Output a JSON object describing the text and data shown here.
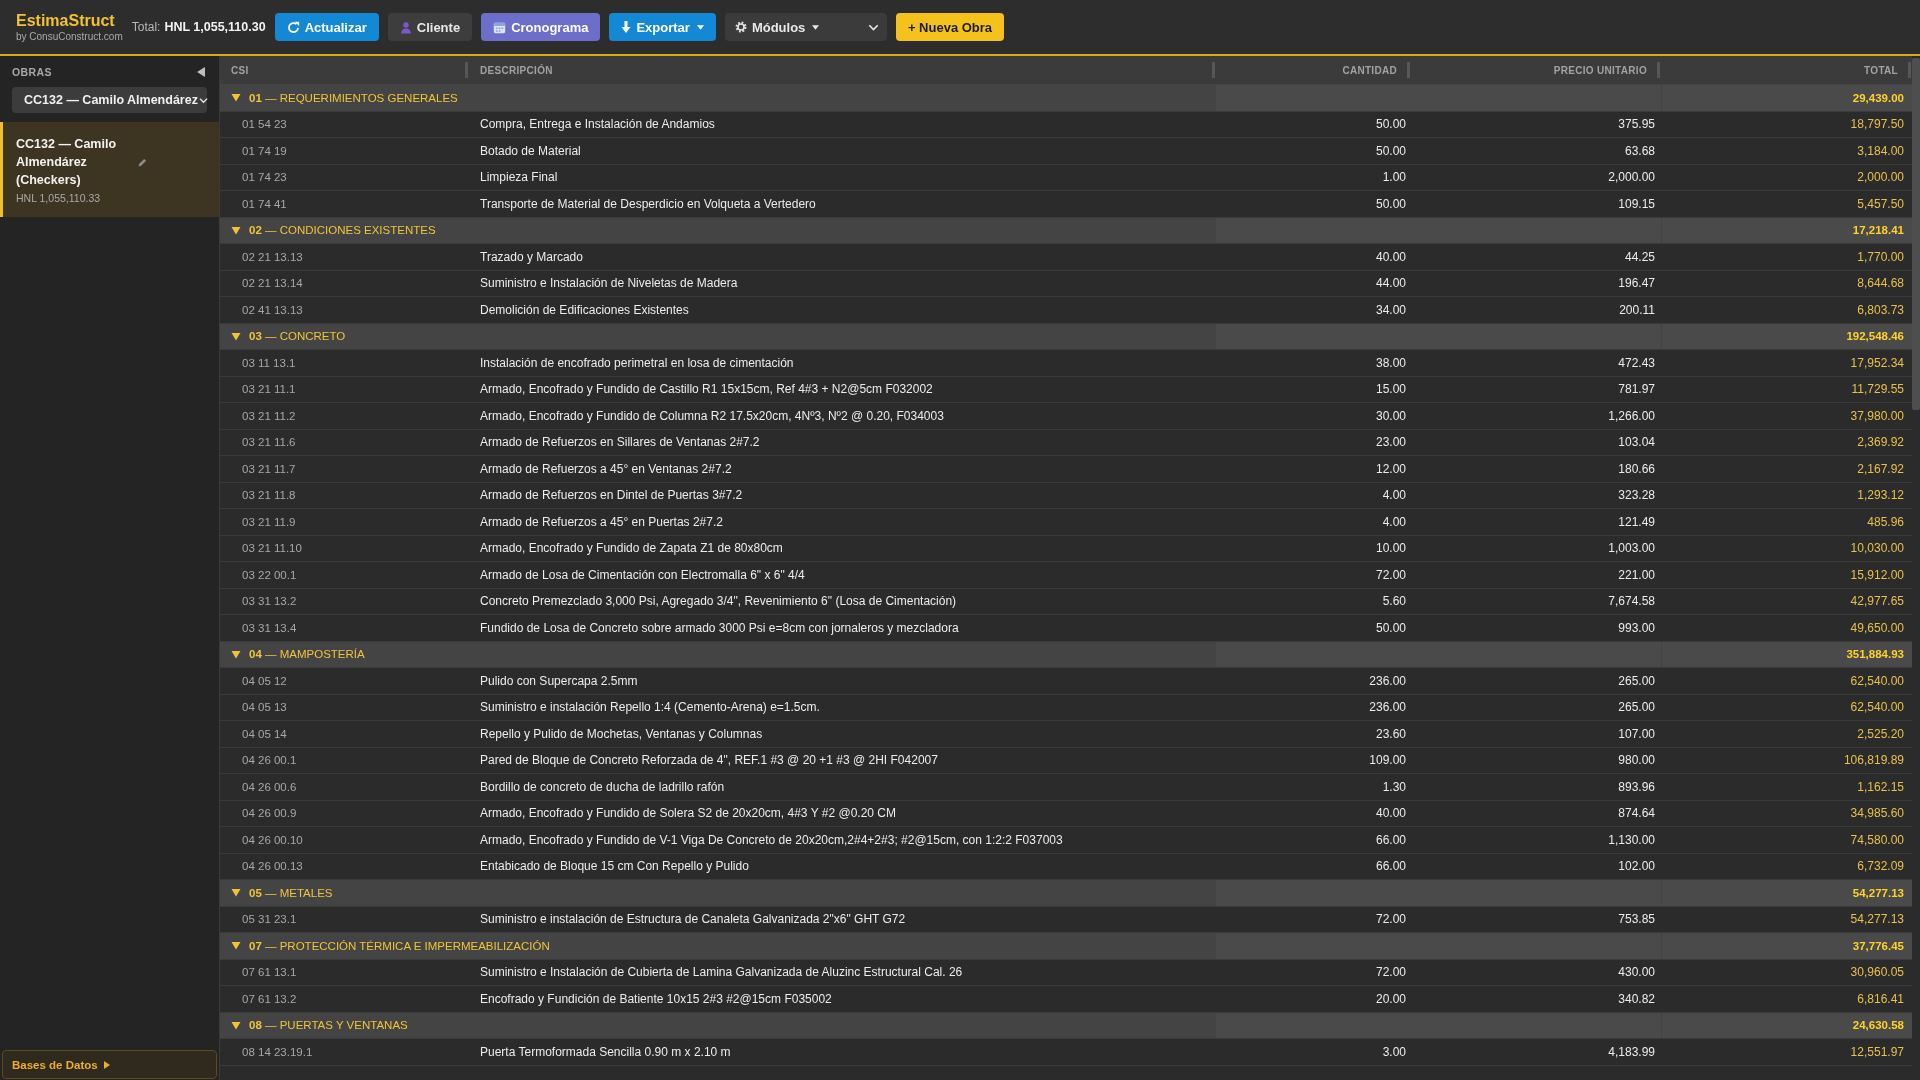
{
  "app": {
    "title": "EstimaStruct",
    "subtitle": "by ConsuConstruct.com"
  },
  "toolbar": {
    "total_label": "Total:",
    "total_value": "HNL 1,055,110.30",
    "controls": [
      {
        "kind": "refresh",
        "label": "Actualizar",
        "menu": false
      },
      {
        "kind": "client",
        "label": "Cliente",
        "menu": false
      },
      {
        "kind": "schedule",
        "label": "Cronograma",
        "menu": false
      },
      {
        "kind": "export",
        "label": "Exportar",
        "menu": true
      },
      {
        "kind": "select",
        "label": "Módulos",
        "menu": true
      },
      {
        "kind": "add",
        "label": "+ Nueva Obra",
        "menu": false
      }
    ]
  },
  "sidebar": {
    "title": "OBRAS",
    "project_select": {
      "value": "CC132 — Camilo Almendárez"
    },
    "projects": [
      {
        "name": "CC132 — Camilo Almendárez (Checkers)",
        "amount": "HNL 1,055,110.33",
        "selected": true
      }
    ],
    "footer_button": {
      "label": "Bases de Datos"
    }
  },
  "table": {
    "columns": [
      "CSI",
      "DESCRIPCIÓN",
      "CANTIDAD",
      "PRECIO UNITARIO",
      "TOTAL"
    ],
    "groups": [
      {
        "label": "**01** — REQUERIMIENTOS GENERALES",
        "total": "29,439.00",
        "expanded": true,
        "rows": [
          {
            "csi": "01 54 23",
            "description": "Compra, Entrega e Instalación de Andamios",
            "quantity": "50.00",
            "unit_price": "375.95",
            "total": "18,797.50"
          },
          {
            "csi": "01 74 19",
            "description": "Botado de Material",
            "quantity": "50.00",
            "unit_price": "63.68",
            "total": "3,184.00"
          },
          {
            "csi": "01 74 23",
            "description": "Limpieza Final",
            "quantity": "1.00",
            "unit_price": "2,000.00",
            "total": "2,000.00"
          },
          {
            "csi": "01 74 41",
            "description": "Transporte de Material de Desperdicio en Volqueta a Vertedero",
            "quantity": "50.00",
            "unit_price": "109.15",
            "total": "5,457.50"
          }
        ]
      },
      {
        "label": "**02** — CONDICIONES EXISTENTES",
        "total": "17,218.41",
        "expanded": true,
        "rows": [
          {
            "csi": "02 21 13.13",
            "description": "Trazado y Marcado",
            "quantity": "40.00",
            "unit_price": "44.25",
            "total": "1,770.00"
          },
          {
            "csi": "02 21 13.14",
            "description": "Suministro e Instalación de Niveletas de Madera",
            "quantity": "44.00",
            "unit_price": "196.47",
            "total": "8,644.68"
          },
          {
            "csi": "02 41 13.13",
            "description": "Demolición de Edificaciones Existentes",
            "quantity": "34.00",
            "unit_price": "200.11",
            "total": "6,803.73"
          }
        ]
      },
      {
        "label": "**03** — CONCRETO",
        "total": "192,548.46",
        "expanded": true,
        "rows": [
          {
            "csi": "03 11 13.1",
            "description": "Instalación de encofrado perimetral en losa de cimentación",
            "quantity": "38.00",
            "unit_price": "472.43",
            "total": "17,952.34"
          },
          {
            "csi": "03 21 11.1",
            "description": "Armado, Encofrado y Fundido de Castillo R1 15x15cm, Ref 4#3 + N2@5cm F032002",
            "quantity": "15.00",
            "unit_price": "781.97",
            "total": "11,729.55"
          },
          {
            "csi": "03 21 11.2",
            "description": "Armado, Encofrado y Fundido de Columna R2 17.5x20cm, 4Nº3, Nº2 @ 0.20, F034003",
            "quantity": "30.00",
            "unit_price": "1,266.00",
            "total": "37,980.00"
          },
          {
            "csi": "03 21 11.6",
            "description": "Armado de Refuerzos en Sillares de Ventanas 2#7.2",
            "quantity": "23.00",
            "unit_price": "103.04",
            "total": "2,369.92"
          },
          {
            "csi": "03 21 11.7",
            "description": "Armado de Refuerzos a 45° en Ventanas 2#7.2",
            "quantity": "12.00",
            "unit_price": "180.66",
            "total": "2,167.92"
          },
          {
            "csi": "03 21 11.8",
            "description": "Armado de Refuerzos en Dintel de Puertas 3#7.2",
            "quantity": "4.00",
            "unit_price": "323.28",
            "total": "1,293.12"
          },
          {
            "csi": "03 21 11.9",
            "description": "Armado de Refuerzos a 45° en Puertas 2#7.2",
            "quantity": "4.00",
            "unit_price": "121.49",
            "total": "485.96"
          },
          {
            "csi": "03 21 11.10",
            "description": "Armado, Encofrado y Fundido de Zapata Z1 de 80x80cm",
            "quantity": "10.00",
            "unit_price": "1,003.00",
            "total": "10,030.00"
          },
          {
            "csi": "03 22 00.1",
            "description": "Armado de Losa de Cimentación con Electromalla 6\" x 6\" 4/4",
            "quantity": "72.00",
            "unit_price": "221.00",
            "total": "15,912.00"
          },
          {
            "csi": "03 31 13.2",
            "description": "Concreto Premezclado 3,000 Psi, Agregado 3/4\", Revenimiento 6\" (Losa de Cimentación)",
            "quantity": "5.60",
            "unit_price": "7,674.58",
            "total": "42,977.65"
          },
          {
            "csi": "03 31 13.4",
            "description": "Fundido de Losa de Concreto sobre armado 3000 Psi e=8cm con jornaleros y mezcladora",
            "quantity": "50.00",
            "unit_price": "993.00",
            "total": "49,650.00"
          }
        ]
      },
      {
        "label": "**04** — MAMPOSTERÍA",
        "total": "351,884.93",
        "expanded": true,
        "rows": [
          {
            "csi": "04 05 12",
            "description": "Pulido con Supercapa 2.5mm",
            "quantity": "236.00",
            "unit_price": "265.00",
            "total": "62,540.00"
          },
          {
            "csi": "04 05 13",
            "description": "Suministro e instalación Repello 1:4 (Cemento-Arena) e=1.5cm.",
            "quantity": "236.00",
            "unit_price": "265.00",
            "total": "62,540.00"
          },
          {
            "csi": "04 05 14",
            "description": "Repello y Pulido de Mochetas, Ventanas y Columnas",
            "quantity": "23.60",
            "unit_price": "107.00",
            "total": "2,525.20"
          },
          {
            "csi": "04 26 00.1",
            "description": "Pared de Bloque de Concreto Reforzada de 4\", REF.1 #3 @ 20 +1 #3 @ 2HI F042007",
            "quantity": "109.00",
            "unit_price": "980.00",
            "total": "106,819.89"
          },
          {
            "csi": "04 26 00.6",
            "description": "Bordillo de concreto de ducha de ladrillo rafón",
            "quantity": "1.30",
            "unit_price": "893.96",
            "total": "1,162.15"
          },
          {
            "csi": "04 26 00.9",
            "description": "Armado, Encofrado y Fundido de Solera S2 de 20x20cm, 4#3 Y #2 @0.20 CM",
            "quantity": "40.00",
            "unit_price": "874.64",
            "total": "34,985.60"
          },
          {
            "csi": "04 26 00.10",
            "description": "Armado, Encofrado y Fundido de V-1 Viga De Concreto de 20x20cm,2#4+2#3; #2@15cm, con 1:2:2 F037003",
            "quantity": "66.00",
            "unit_price": "1,130.00",
            "total": "74,580.00"
          },
          {
            "csi": "04 26 00.13",
            "description": "Entabicado de Bloque 15 cm Con Repello y Pulido",
            "quantity": "66.00",
            "unit_price": "102.00",
            "total": "6,732.09"
          }
        ]
      },
      {
        "label": "**05** — METALES",
        "total": "54,277.13",
        "expanded": true,
        "rows": [
          {
            "csi": "05 31 23.1",
            "description": "Suministro e instalación de Estructura de Canaleta Galvanizada 2\"x6\" GHT G72",
            "quantity": "72.00",
            "unit_price": "753.85",
            "total": "54,277.13"
          }
        ]
      },
      {
        "label": "**07** — PROTECCIÓN TÉRMICA E IMPERMEABILIZACIÓN",
        "total": "37,776.45",
        "expanded": true,
        "rows": [
          {
            "csi": "07 61 13.1",
            "description": "Suministro e Instalación de Cubierta de Lamina Galvanizada de Aluzinc Estructural Cal. 26",
            "quantity": "72.00",
            "unit_price": "430.00",
            "total": "30,960.05"
          },
          {
            "csi": "07 61 13.2",
            "description": "Encofrado y Fundición de Batiente 10x15 2#3 #2@15cm F035002",
            "quantity": "20.00",
            "unit_price": "340.82",
            "total": "6,816.41"
          }
        ]
      },
      {
        "label": "**08** — PUERTAS Y VENTANAS",
        "total": "24,630.58",
        "expanded": true,
        "rows": [
          {
            "csi": "08 14 23.19.1",
            "description": "Puerta Termoformada Sencilla 0.90 m x 2.10 m",
            "quantity": "3.00",
            "unit_price": "4,183.99",
            "total": "12,551.97"
          }
        ]
      }
    ]
  }
}
